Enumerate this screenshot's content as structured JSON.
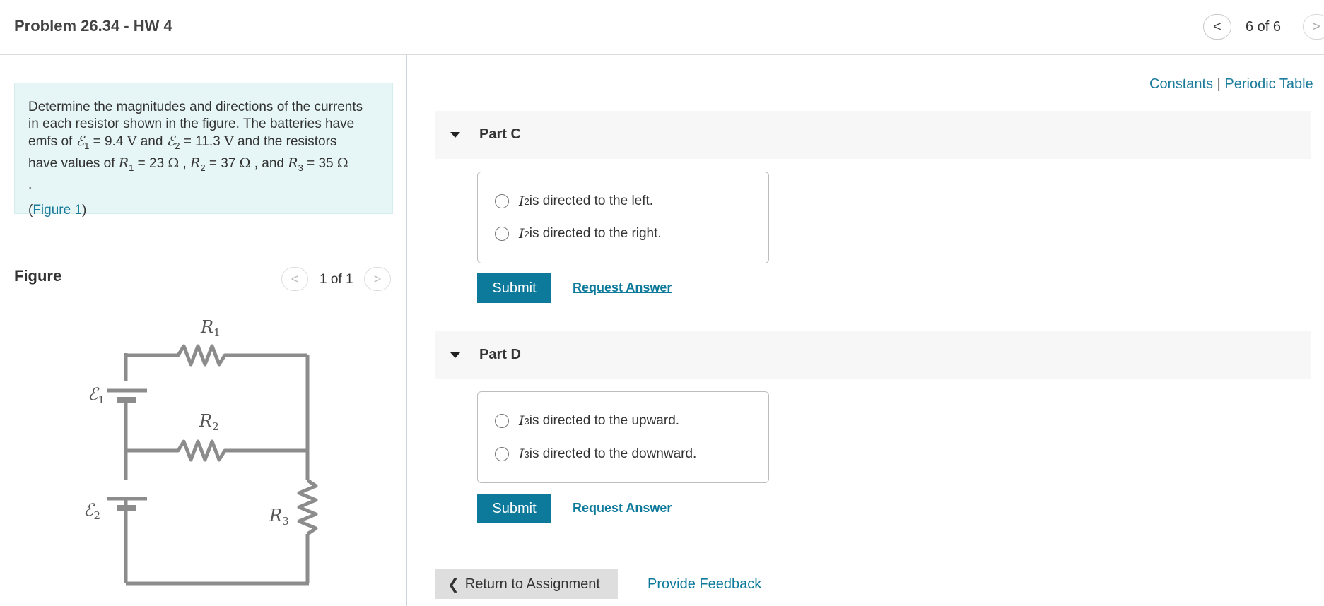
{
  "header": {
    "title": "Problem 26.34 - HW 4",
    "prev_symbol": "<",
    "next_symbol": ">",
    "position": "6 of 6"
  },
  "problem": {
    "line1": "Determine the magnitudes and directions of the currents",
    "line2": "in each resistor shown in the figure. The batteries have",
    "emfs_of": "emfs of ",
    "e1_sym": "ℰ",
    "e1_sub": "1",
    "e1_val": " = 9.4 ",
    "volt": "V",
    "and1": " and ",
    "e2_sym": "ℰ",
    "e2_sub": "2",
    "e2_val": " = 11.3 ",
    "and_res": " and the resistors",
    "have_values": "have values of ",
    "r1_sym": "R",
    "r1_sub": "1",
    "r1_val": " = 23 ",
    "ohm": "Ω",
    "comma": " , ",
    "r2_sym": "R",
    "r2_sub": "2",
    "r2_val": " = 37 ",
    "and2": " , and ",
    "r3_sym": "R",
    "r3_sub": "3",
    "r3_val": " = 35 ",
    "period": ".",
    "fig_open": "(",
    "fig_link": "Figure 1",
    "fig_close": ")"
  },
  "figure": {
    "heading": "Figure",
    "prev_symbol": "<",
    "next_symbol": ">",
    "count": "1 of 1",
    "labels": {
      "r1": "R",
      "r1_sub": "1",
      "r2": "R",
      "r2_sub": "2",
      "r3": "R",
      "r3_sub": "3",
      "e1": "ℰ",
      "e1_sub": "1",
      "e2": "ℰ",
      "e2_sub": "2"
    }
  },
  "links": {
    "constants": "Constants",
    "separator": " | ",
    "periodic": "Periodic Table"
  },
  "parts": [
    {
      "label": "Part C",
      "options": [
        {
          "sym": "I",
          "sub": "2",
          "text": " is directed to the left."
        },
        {
          "sym": "I",
          "sub": "2",
          "text": " is directed to the right."
        }
      ],
      "submit": "Submit",
      "request": "Request Answer"
    },
    {
      "label": "Part D",
      "options": [
        {
          "sym": "I",
          "sub": "3",
          "text": " is directed to the upward."
        },
        {
          "sym": "I",
          "sub": "3",
          "text": " is directed to the downward."
        }
      ],
      "submit": "Submit",
      "request": "Request Answer"
    }
  ],
  "footer": {
    "return_chevron": "❮",
    "return_label": "Return to Assignment",
    "feedback": "Provide Feedback"
  },
  "colors": {
    "accent": "#0e7a9b",
    "problem_bg": "#e6f5f5",
    "wire": "#8c8c8c"
  }
}
